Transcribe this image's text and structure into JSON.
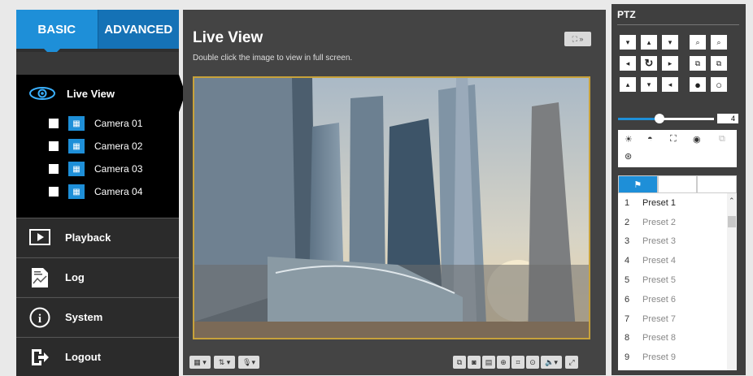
{
  "tabs": {
    "basic": "BASIC",
    "advanced": "ADVANCED"
  },
  "sidebar": {
    "live_view": "Live View",
    "cameras": [
      "Camera 01",
      "Camera 02",
      "Camera 03",
      "Camera 04"
    ],
    "playback": "Playback",
    "log": "Log",
    "system": "System",
    "logout": "Logout"
  },
  "main": {
    "title": "Live View",
    "subtitle": "Double click the image to view in full screen."
  },
  "ptz": {
    "title": "PTZ",
    "speed_value": "4",
    "speed_fraction": 0.43,
    "presets": [
      {
        "num": "1",
        "label": "Preset 1"
      },
      {
        "num": "2",
        "label": "Preset 2"
      },
      {
        "num": "3",
        "label": "Preset 3"
      },
      {
        "num": "4",
        "label": "Preset 4"
      },
      {
        "num": "5",
        "label": "Preset 5"
      },
      {
        "num": "6",
        "label": "Preset 6"
      },
      {
        "num": "7",
        "label": "Preset 7"
      },
      {
        "num": "8",
        "label": "Preset 8"
      },
      {
        "num": "9",
        "label": "Preset 9"
      }
    ]
  },
  "colors": {
    "accent": "#1e8fd8",
    "video_border": "#c8a23a"
  }
}
